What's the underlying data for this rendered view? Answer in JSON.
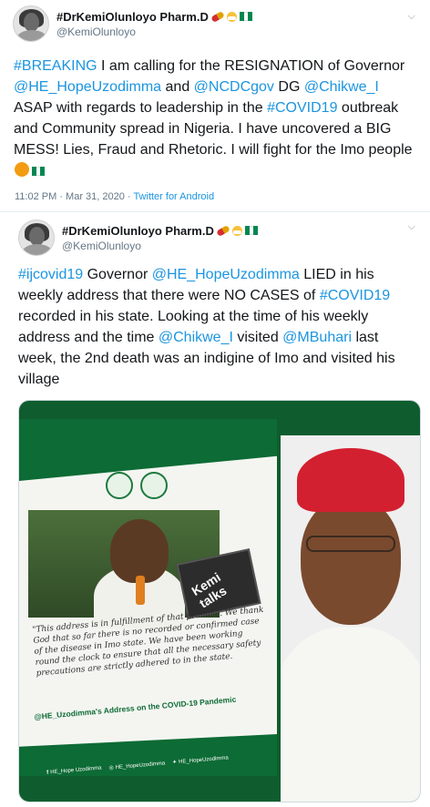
{
  "tweets": [
    {
      "display_name": "#DrKemiOlunloyo Pharm.D",
      "handle": "@KemiOlunloyo",
      "text_parts": [
        {
          "t": "#BREAKING",
          "link": true
        },
        {
          "t": "  I am calling for the RESIGNATION of Governor ",
          "link": false
        },
        {
          "t": "@HE_HopeUzodimma",
          "link": true
        },
        {
          "t": " and ",
          "link": false
        },
        {
          "t": "@NCDCgov",
          "link": true
        },
        {
          "t": " DG ",
          "link": false
        },
        {
          "t": "@Chikwe_I",
          "link": true
        },
        {
          "t": " ASAP with regards to leadership in the ",
          "link": false
        },
        {
          "t": "#COVID19",
          "link": true
        },
        {
          "t": " outbreak and Community spread in Nigeria. I have uncovered a BIG MESS! Lies, Fraud and Rhetoric. I will fight for the Imo people",
          "link": false
        }
      ],
      "timestamp": "11:02 PM · Mar 31, 2020 · ",
      "source": "Twitter for Android"
    },
    {
      "display_name": "#DrKemiOlunloyo Pharm.D",
      "handle": "@KemiOlunloyo",
      "text_parts": [
        {
          "t": "#ijcovid19",
          "link": true
        },
        {
          "t": " Governor ",
          "link": false
        },
        {
          "t": "@HE_HopeUzodimma",
          "link": true
        },
        {
          "t": " LIED in his weekly address that there were NO CASES of ",
          "link": false
        },
        {
          "t": "#COVID19",
          "link": true
        },
        {
          "t": "  recorded in his state. Looking at the time of his weekly address and the time ",
          "link": false
        },
        {
          "t": "@Chikwe_I",
          "link": true
        },
        {
          "t": " visited ",
          "link": false
        },
        {
          "t": "@MBuhari",
          "link": true
        },
        {
          "t": " last week, the 2nd death was an indigine of Imo and visited his village",
          "link": false
        }
      ]
    }
  ],
  "media": {
    "logo_text": "Kemi talks",
    "quote": "\"This address is in fulfillment of that promise. We thank God that so far there is no recorded or confirmed case of the disease in Imo state. We have been working round the clock to ensure that all the necessary safety precautions are strictly adhered to in the state.",
    "caption": "@HE_Uzodimma's Address on the COVID-19 Pandemic",
    "socials": [
      {
        "icon": "f",
        "label": "HE_Hope Uzodimma"
      },
      {
        "icon": "◎",
        "label": "HE_HopeUzodimma"
      },
      {
        "icon": "✦",
        "label": "HE_HopeUzodimma"
      }
    ]
  },
  "icons": {
    "chevron": "chevron-down-icon",
    "pill": "pill-emoji",
    "mask": "mask-emoji",
    "flag": "nigeria-flag-emoji",
    "angry": "angry-face-emoji"
  },
  "colors": {
    "link": "#1b95e0",
    "brand_green": "#0d6b35",
    "muted": "#657786"
  }
}
